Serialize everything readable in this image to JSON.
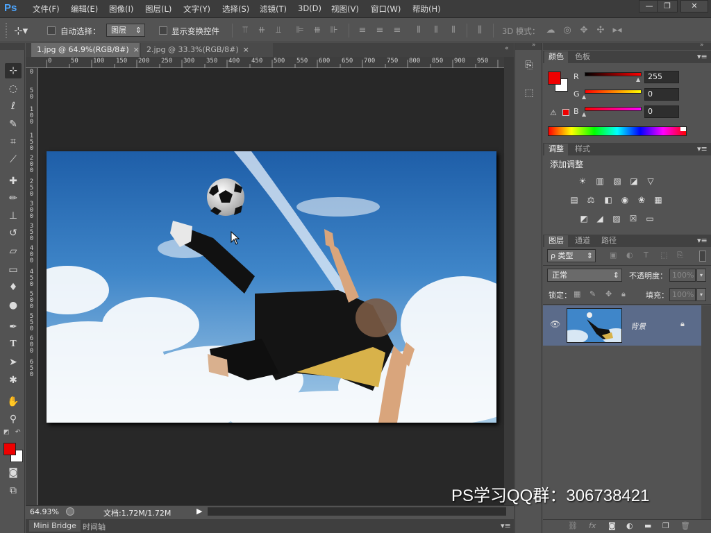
{
  "app": {
    "logo": "Ps",
    "colors": {
      "accent": "#4da6ff",
      "foreground": "#ee0000",
      "background": "#ffffff"
    }
  },
  "menu": [
    "文件(F)",
    "编辑(E)",
    "图像(I)",
    "图层(L)",
    "文字(Y)",
    "选择(S)",
    "滤镜(T)",
    "3D(D)",
    "视图(V)",
    "窗口(W)",
    "帮助(H)"
  ],
  "window_controls": {
    "minimize": "—",
    "maximize": "❐",
    "close": "✕"
  },
  "options_bar": {
    "auto_select_label": "自动选择：",
    "auto_select_value": "图层",
    "show_transform_label": "显示变换控件",
    "mode_3d_label": "3D 模式："
  },
  "tabs": [
    {
      "label": "1.jpg @ 64.9%(RGB/8#)",
      "close": "×"
    },
    {
      "label": "2.jpg @ 33.3%(RGB/8#)",
      "close": "×"
    }
  ],
  "ruler_h": [
    "0",
    "50",
    "100",
    "150",
    "200",
    "250",
    "300",
    "350",
    "400",
    "450",
    "500",
    "550",
    "600",
    "650",
    "700",
    "750",
    "800",
    "850",
    "900",
    "950"
  ],
  "ruler_v": [
    "0",
    "5",
    "0",
    "1",
    "0",
    "0",
    "1",
    "5",
    "0",
    "2",
    "0",
    "0",
    "2",
    "5",
    "0",
    "3",
    "0",
    "0",
    "3",
    "5",
    "0",
    "4",
    "0",
    "0",
    "4",
    "5",
    "0",
    "5",
    "0",
    "0",
    "5",
    "5",
    "0",
    "6",
    "0",
    "0",
    "6",
    "5",
    "0"
  ],
  "status": {
    "zoom": "64.93%",
    "doc_size": "文档:1.72M/1.72M"
  },
  "bottom_tabs": {
    "mini_bridge": "Mini Bridge",
    "timeline": "时间轴"
  },
  "color_panel": {
    "tabs": [
      "颜色",
      "色板"
    ],
    "r_label": "R",
    "g_label": "G",
    "b_label": "B",
    "r_value": "255",
    "g_value": "0",
    "b_value": "0"
  },
  "adjust_panel": {
    "tabs": [
      "调整",
      "样式"
    ],
    "title": "添加调整"
  },
  "layers_panel": {
    "tabs": [
      "图层",
      "通道",
      "路径"
    ],
    "filter_kind": "ρ 类型",
    "blend_mode": "正常",
    "opacity_label": "不透明度：",
    "opacity_value": "100%",
    "lock_label": "锁定：",
    "fill_label": "填充：",
    "fill_value": "100%",
    "layer_name": "背景"
  },
  "watermark": "PS学习QQ群：306738421"
}
